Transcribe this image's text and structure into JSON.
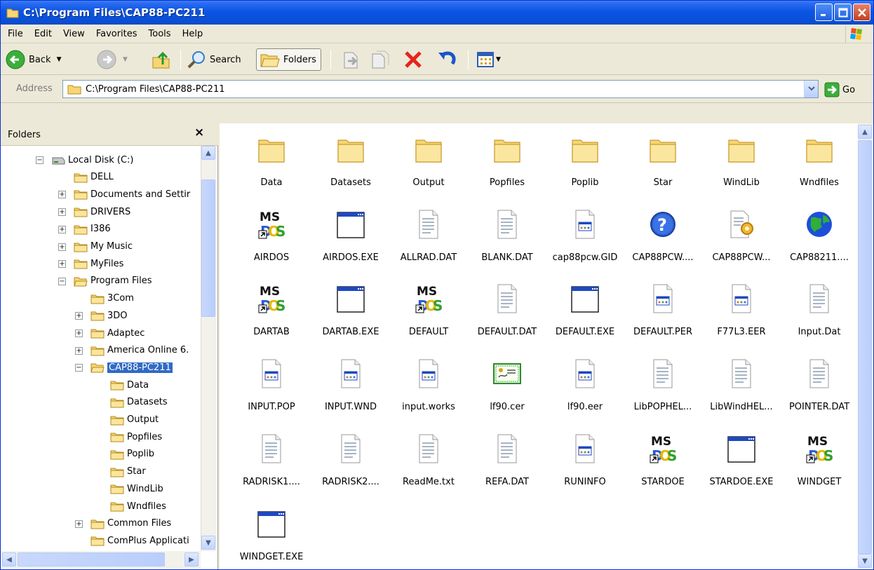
{
  "window": {
    "title": "C:\\Program Files\\CAP88-PC211"
  },
  "menu": [
    "File",
    "Edit",
    "View",
    "Favorites",
    "Tools",
    "Help"
  ],
  "toolbar": {
    "back_label": "Back",
    "search_label": "Search",
    "folders_label": "Folders"
  },
  "address": {
    "label": "Address",
    "value": "C:\\Program Files\\CAP88-PC211",
    "go_label": "Go"
  },
  "folders_pane": {
    "title": "Folders",
    "tree": [
      {
        "label": "Local Disk (C:)",
        "level": 0,
        "expander": "minus",
        "icon": "drive-icon"
      },
      {
        "label": "DELL",
        "level": 1,
        "expander": "",
        "icon": "folder-icon"
      },
      {
        "label": "Documents and Settir",
        "level": 1,
        "expander": "plus",
        "icon": "folder-icon"
      },
      {
        "label": "DRIVERS",
        "level": 1,
        "expander": "plus",
        "icon": "folder-icon"
      },
      {
        "label": "I386",
        "level": 1,
        "expander": "plus",
        "icon": "folder-icon"
      },
      {
        "label": "My Music",
        "level": 1,
        "expander": "plus",
        "icon": "folder-icon"
      },
      {
        "label": "MyFiles",
        "level": 1,
        "expander": "plus",
        "icon": "folder-icon"
      },
      {
        "label": "Program Files",
        "level": 1,
        "expander": "minus",
        "icon": "open-folder-icon"
      },
      {
        "label": "3Com",
        "level": 2,
        "expander": "",
        "icon": "folder-icon"
      },
      {
        "label": "3DO",
        "level": 2,
        "expander": "plus",
        "icon": "folder-icon"
      },
      {
        "label": "Adaptec",
        "level": 2,
        "expander": "plus",
        "icon": "folder-icon"
      },
      {
        "label": "America Online 6.",
        "level": 2,
        "expander": "plus",
        "icon": "folder-icon"
      },
      {
        "label": "CAP88-PC211",
        "level": 2,
        "expander": "minus",
        "icon": "open-folder-icon",
        "selected": true
      },
      {
        "label": "Data",
        "level": 3,
        "expander": "",
        "icon": "folder-icon"
      },
      {
        "label": "Datasets",
        "level": 3,
        "expander": "",
        "icon": "folder-icon"
      },
      {
        "label": "Output",
        "level": 3,
        "expander": "",
        "icon": "folder-icon"
      },
      {
        "label": "Popfiles",
        "level": 3,
        "expander": "",
        "icon": "folder-icon"
      },
      {
        "label": "Poplib",
        "level": 3,
        "expander": "",
        "icon": "folder-icon"
      },
      {
        "label": "Star",
        "level": 3,
        "expander": "",
        "icon": "folder-icon"
      },
      {
        "label": "WindLib",
        "level": 3,
        "expander": "",
        "icon": "folder-icon"
      },
      {
        "label": "Wndfiles",
        "level": 3,
        "expander": "",
        "icon": "folder-icon"
      },
      {
        "label": "Common Files",
        "level": 2,
        "expander": "plus",
        "icon": "folder-icon"
      },
      {
        "label": "ComPlus Applicati",
        "level": 2,
        "expander": "",
        "icon": "folder-icon"
      }
    ]
  },
  "files": [
    {
      "name": "Data",
      "icon": "folder-icon"
    },
    {
      "name": "Datasets",
      "icon": "folder-icon"
    },
    {
      "name": "Output",
      "icon": "folder-icon"
    },
    {
      "name": "Popfiles",
      "icon": "folder-icon"
    },
    {
      "name": "Poplib",
      "icon": "folder-icon"
    },
    {
      "name": "Star",
      "icon": "folder-icon"
    },
    {
      "name": "WindLib",
      "icon": "folder-icon"
    },
    {
      "name": "Wndfiles",
      "icon": "folder-icon"
    },
    {
      "name": "AIRDOS",
      "icon": "msdos-shortcut-icon"
    },
    {
      "name": "AIRDOS.EXE",
      "icon": "exe-window-icon"
    },
    {
      "name": "ALLRAD.DAT",
      "icon": "text-file-icon"
    },
    {
      "name": "BLANK.DAT",
      "icon": "text-file-icon"
    },
    {
      "name": "cap88pcw.GID",
      "icon": "generic-file-icon"
    },
    {
      "name": "CAP88PCW....",
      "icon": "help-icon"
    },
    {
      "name": "CAP88PCW...",
      "icon": "config-file-icon"
    },
    {
      "name": "CAP88211....",
      "icon": "globe-icon"
    },
    {
      "name": "DARTAB",
      "icon": "msdos-shortcut-icon"
    },
    {
      "name": "DARTAB.EXE",
      "icon": "exe-window-icon"
    },
    {
      "name": "DEFAULT",
      "icon": "msdos-shortcut-icon"
    },
    {
      "name": "DEFAULT.DAT",
      "icon": "text-file-icon"
    },
    {
      "name": "DEFAULT.EXE",
      "icon": "exe-window-icon"
    },
    {
      "name": "DEFAULT.PER",
      "icon": "generic-file-icon"
    },
    {
      "name": "F77L3.EER",
      "icon": "generic-file-icon"
    },
    {
      "name": "Input.Dat",
      "icon": "text-file-icon"
    },
    {
      "name": "INPUT.POP",
      "icon": "generic-file-icon"
    },
    {
      "name": "INPUT.WND",
      "icon": "generic-file-icon"
    },
    {
      "name": "input.works",
      "icon": "generic-file-icon"
    },
    {
      "name": "lf90.cer",
      "icon": "certificate-icon"
    },
    {
      "name": "lf90.eer",
      "icon": "generic-file-icon"
    },
    {
      "name": "LibPOPHEL...",
      "icon": "text-file-icon"
    },
    {
      "name": "LibWindHEL...",
      "icon": "text-file-icon"
    },
    {
      "name": "POINTER.DAT",
      "icon": "text-file-icon"
    },
    {
      "name": "RADRISK1....",
      "icon": "text-file-icon"
    },
    {
      "name": "RADRISK2....",
      "icon": "text-file-icon"
    },
    {
      "name": "ReadMe.txt",
      "icon": "text-file-icon"
    },
    {
      "name": "REFA.DAT",
      "icon": "text-file-icon"
    },
    {
      "name": "RUNINFO",
      "icon": "generic-file-icon"
    },
    {
      "name": "STARDOE",
      "icon": "msdos-shortcut-icon"
    },
    {
      "name": "STARDOE.EXE",
      "icon": "exe-window-icon"
    },
    {
      "name": "WINDGET",
      "icon": "msdos-shortcut-icon"
    },
    {
      "name": "WINDGET.EXE",
      "icon": "exe-window-icon"
    }
  ],
  "colors": {
    "title_bar": "#0a50d8",
    "selection": "#316ac5",
    "folder": "#f6d675"
  }
}
